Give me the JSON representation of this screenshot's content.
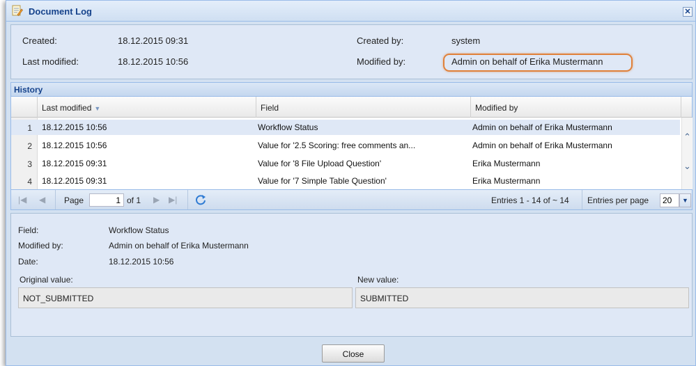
{
  "window": {
    "title": "Document Log",
    "close_glyph": "✕"
  },
  "info": {
    "created_label": "Created:",
    "created_value": "18.12.2015 09:31",
    "last_modified_label": "Last modified:",
    "last_modified_value": "18.12.2015 10:56",
    "created_by_label": "Created by:",
    "created_by_value": "system",
    "modified_by_label": "Modified by:",
    "modified_by_value": "Admin on behalf of Erika Mustermann"
  },
  "history": {
    "title": "History",
    "columns": {
      "last_modified": "Last modified",
      "field": "Field",
      "modified_by": "Modified by"
    },
    "rows": [
      {
        "num": "1",
        "date": "18.12.2015 10:56",
        "field": "Workflow Status",
        "by": "Admin on behalf of Erika Mustermann"
      },
      {
        "num": "2",
        "date": "18.12.2015 10:56",
        "field": "Value for '2.5 Scoring: free comments an...",
        "by": "Admin on behalf of Erika Mustermann"
      },
      {
        "num": "3",
        "date": "18.12.2015 09:31",
        "field": "Value for '8 File Upload Question'",
        "by": "Erika Mustermann"
      },
      {
        "num": "4",
        "date": "18.12.2015 09:31",
        "field": "Value for '7 Simple Table Question'",
        "by": "Erika Mustermann"
      }
    ]
  },
  "pager": {
    "page_label": "Page",
    "page_value": "1",
    "of_label": "of 1",
    "entries_label": "Entries 1 - 14 of ~ 14",
    "per_page_label": "Entries per page",
    "per_page_value": "20"
  },
  "detail": {
    "field_label": "Field:",
    "field_value": "Workflow Status",
    "modified_by_label": "Modified by:",
    "modified_by_value": "Admin on behalf of Erika Mustermann",
    "date_label": "Date:",
    "date_value": "18.12.2015 10:56",
    "original_label": "Original value:",
    "original_value": "NOT_SUBMITTED",
    "new_label": "New value:",
    "new_value": "SUBMITTED"
  },
  "footer": {
    "close_label": "Close"
  },
  "colors": {
    "accent": "#15428b",
    "highlight": "#e0813a",
    "panel": "#dfe8f6"
  }
}
